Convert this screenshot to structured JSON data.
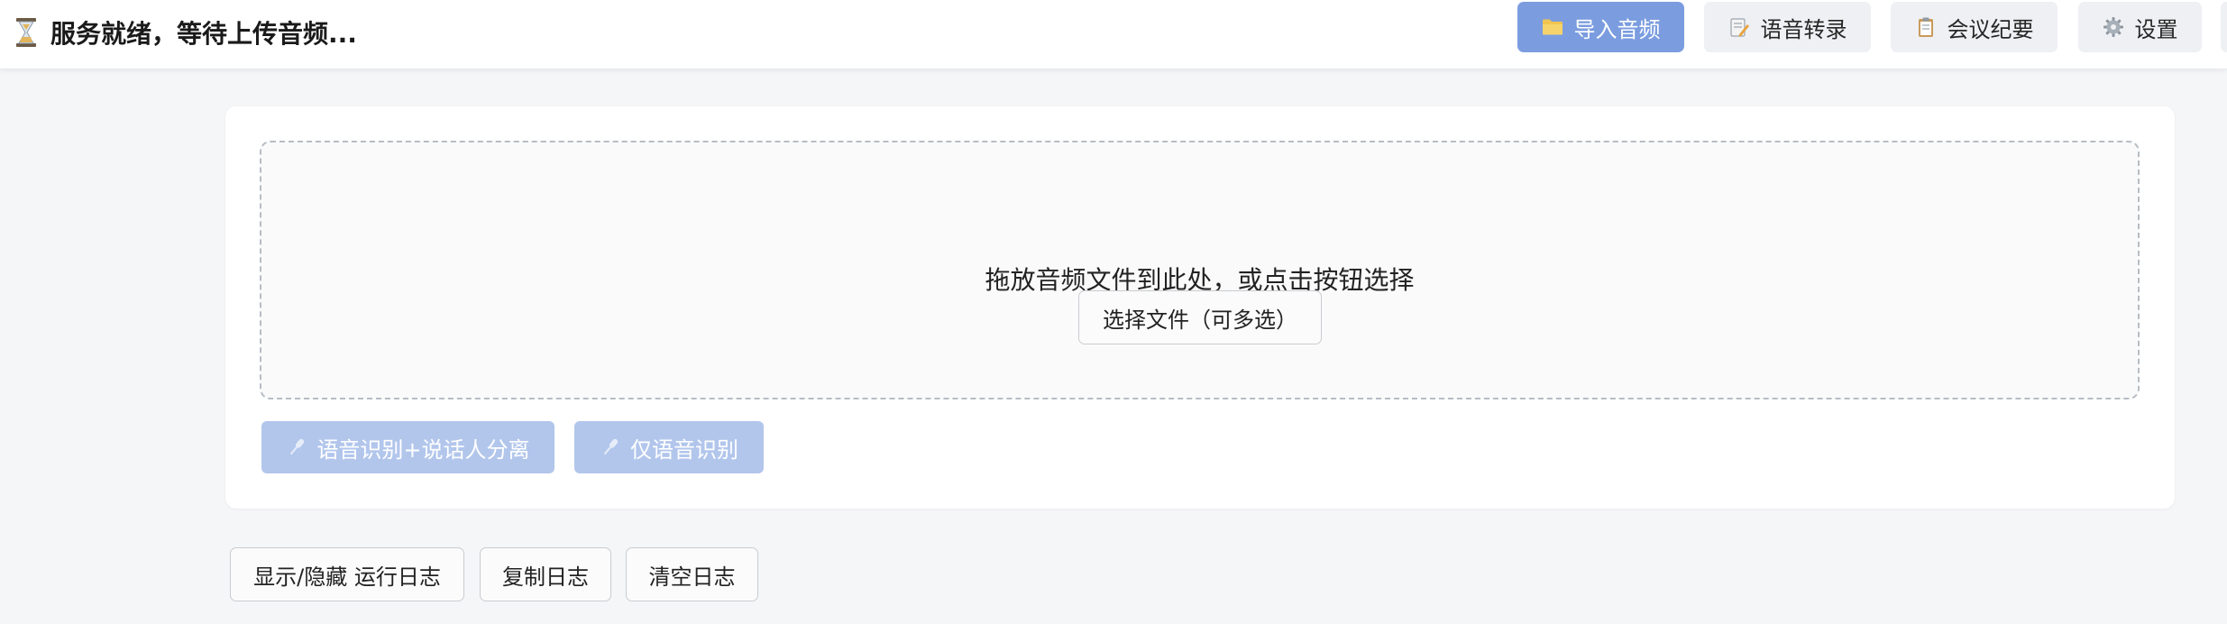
{
  "header": {
    "status_icon": "hourglass-icon",
    "status_text": "服务就绪，等待上传音频...",
    "nav": [
      {
        "label": "导入音频",
        "icon": "folder-icon",
        "active": true
      },
      {
        "label": "语音转录",
        "icon": "memo-icon",
        "active": false
      },
      {
        "label": "会议纪要",
        "icon": "clipboard-icon",
        "active": false
      },
      {
        "label": "设置",
        "icon": "gear-icon",
        "active": false
      }
    ]
  },
  "upload": {
    "drop_hint": "拖放音频文件到此处，或点击按钮选择",
    "choose_label": "选择文件（可多选）",
    "actions": [
      {
        "label": "语音识别+说话人分离",
        "icon": "microphone-icon",
        "enabled": false
      },
      {
        "label": "仅语音识别",
        "icon": "microphone-icon",
        "enabled": false
      }
    ]
  },
  "log": {
    "toggle_label": "显示/隐藏 运行日志",
    "copy_label": "复制日志",
    "clear_label": "清空日志"
  },
  "colors": {
    "accent": "#7b9ddf",
    "disabled_accent": "#b2c6ec",
    "page_bg": "#f5f6f8"
  }
}
